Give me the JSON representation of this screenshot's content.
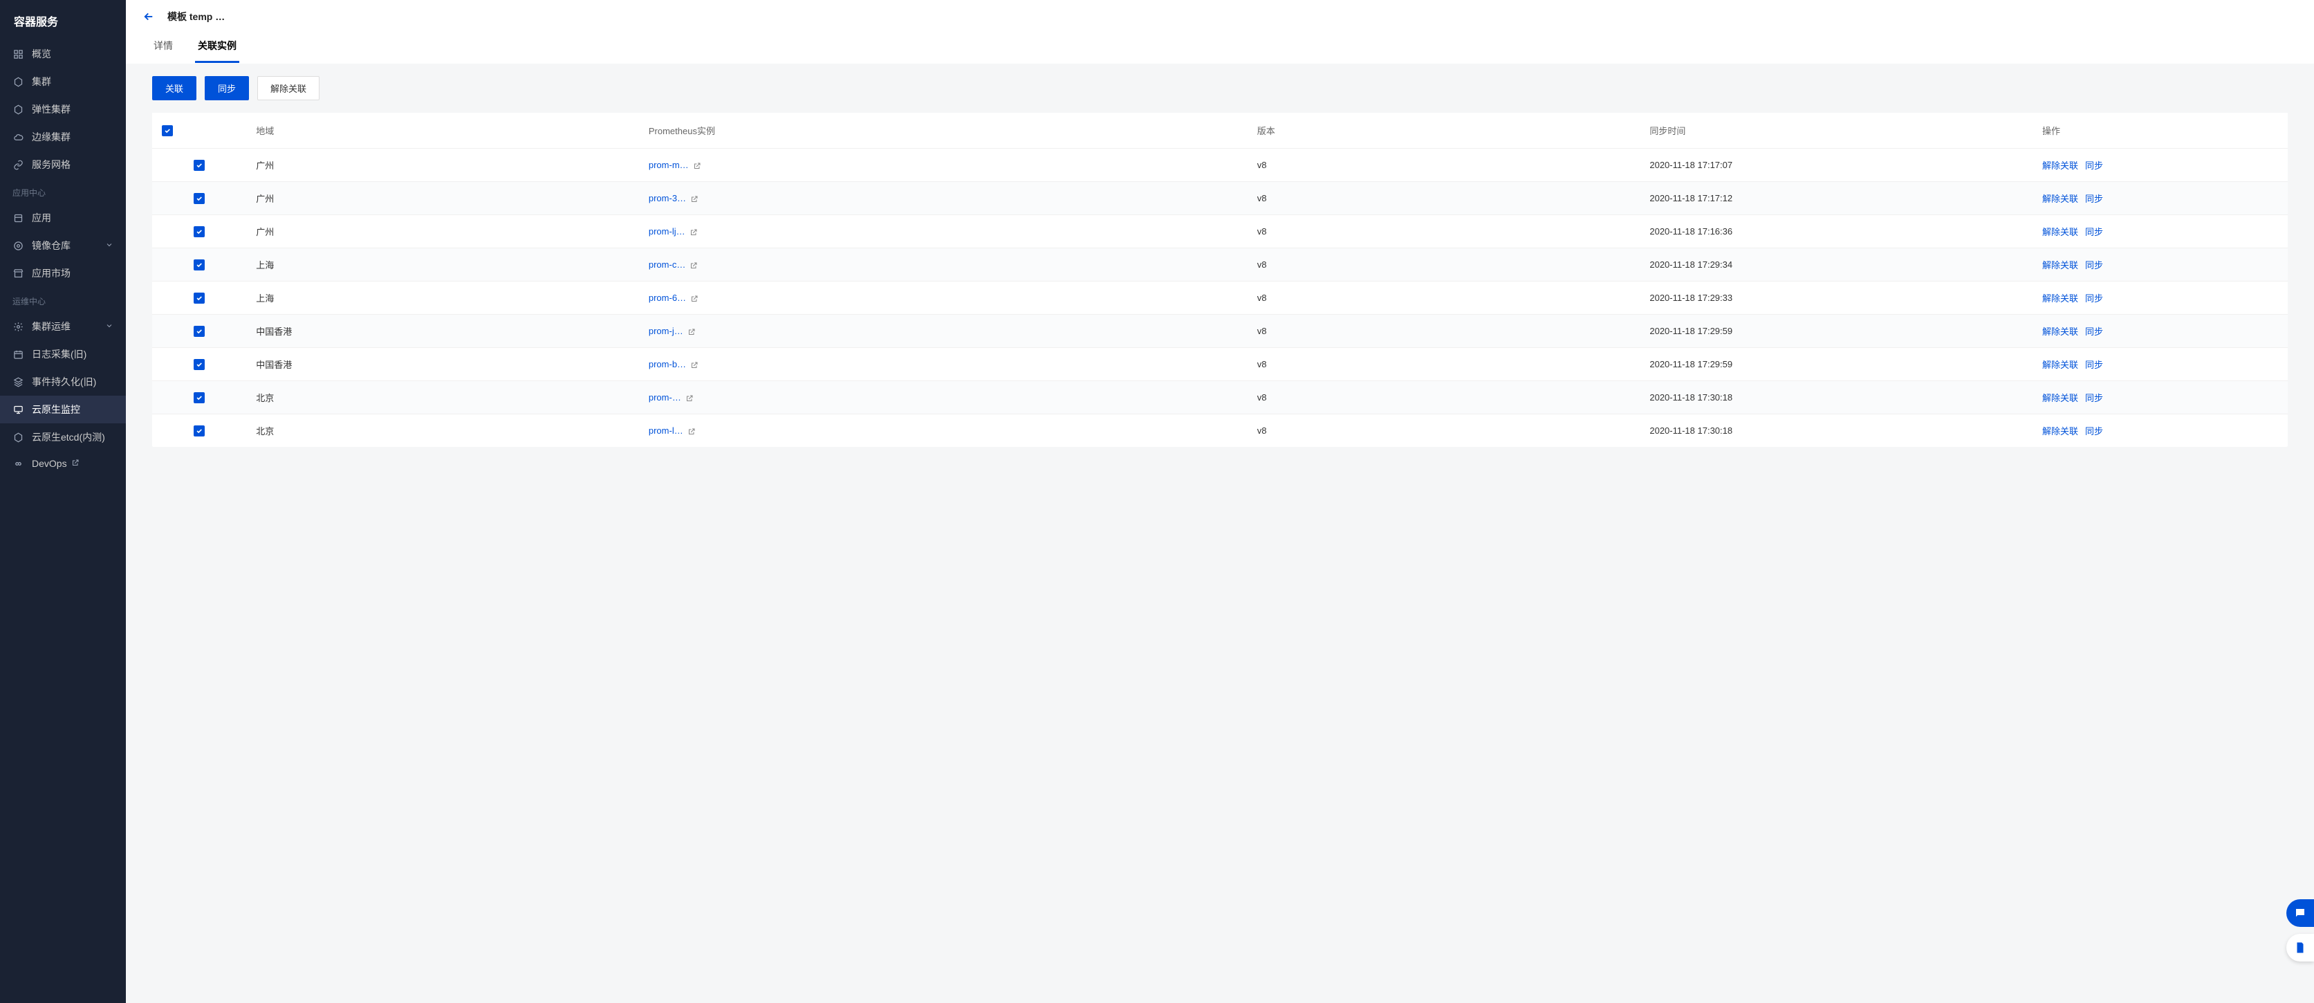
{
  "sidebar": {
    "title": "容器服务",
    "groups": [
      {
        "label": null,
        "items": [
          {
            "name": "overview",
            "label": "概览",
            "icon": "grid"
          },
          {
            "name": "cluster",
            "label": "集群",
            "icon": "hex"
          },
          {
            "name": "elastic-cluster",
            "label": "弹性集群",
            "icon": "hex"
          },
          {
            "name": "edge-cluster",
            "label": "边缘集群",
            "icon": "cloud"
          },
          {
            "name": "service-mesh",
            "label": "服务网格",
            "icon": "link"
          }
        ]
      },
      {
        "label": "应用中心",
        "items": [
          {
            "name": "app",
            "label": "应用",
            "icon": "app"
          },
          {
            "name": "image-repo",
            "label": "镜像仓库",
            "icon": "disc",
            "expandable": true
          },
          {
            "name": "app-market",
            "label": "应用市场",
            "icon": "store"
          }
        ]
      },
      {
        "label": "运维中心",
        "items": [
          {
            "name": "cluster-ops",
            "label": "集群运维",
            "icon": "gear",
            "expandable": true
          },
          {
            "name": "log-old",
            "label": "日志采集(旧)",
            "icon": "calendar"
          },
          {
            "name": "event-persist-old",
            "label": "事件持久化(旧)",
            "icon": "layers"
          },
          {
            "name": "cloud-native-monitor",
            "label": "云原生监控",
            "icon": "monitor",
            "active": true
          },
          {
            "name": "cloud-native-etcd",
            "label": "云原生etcd(内测)",
            "icon": "hex"
          },
          {
            "name": "devops",
            "label": "DevOps",
            "icon": "infinity",
            "external": true
          }
        ]
      }
    ]
  },
  "header": {
    "breadcrumb_prefix": "模板 temp",
    "breadcrumb_redacted": "…",
    "tabs": [
      {
        "key": "detail",
        "label": "详情",
        "active": false
      },
      {
        "key": "linked",
        "label": "关联实例",
        "active": true
      }
    ]
  },
  "actions": {
    "link": "关联",
    "sync": "同步",
    "unlink": "解除关联"
  },
  "table": {
    "headers": {
      "region": "地域",
      "instance": "Prometheus实例",
      "version": "版本",
      "sync_time": "同步时间",
      "ops": "操作"
    },
    "op_unlink": "解除关联",
    "op_sync": "同步",
    "rows": [
      {
        "region": "广州",
        "instance": "prom-m…",
        "version": "v8",
        "sync_time": "2020-11-18 17:17:07"
      },
      {
        "region": "广州",
        "instance": "prom-3…",
        "version": "v8",
        "sync_time": "2020-11-18 17:17:12"
      },
      {
        "region": "广州",
        "instance": "prom-lj…",
        "version": "v8",
        "sync_time": "2020-11-18 17:16:36"
      },
      {
        "region": "上海",
        "instance": "prom-c…",
        "version": "v8",
        "sync_time": "2020-11-18 17:29:34"
      },
      {
        "region": "上海",
        "instance": "prom-6…",
        "version": "v8",
        "sync_time": "2020-11-18 17:29:33"
      },
      {
        "region": "中国香港",
        "instance": "prom-j…",
        "version": "v8",
        "sync_time": "2020-11-18 17:29:59"
      },
      {
        "region": "中国香港",
        "instance": "prom-b…",
        "version": "v8",
        "sync_time": "2020-11-18 17:29:59"
      },
      {
        "region": "北京",
        "instance": "prom-…",
        "version": "v8",
        "sync_time": "2020-11-18 17:30:18"
      },
      {
        "region": "北京",
        "instance": "prom-l…",
        "version": "v8",
        "sync_time": "2020-11-18 17:30:18"
      }
    ]
  }
}
